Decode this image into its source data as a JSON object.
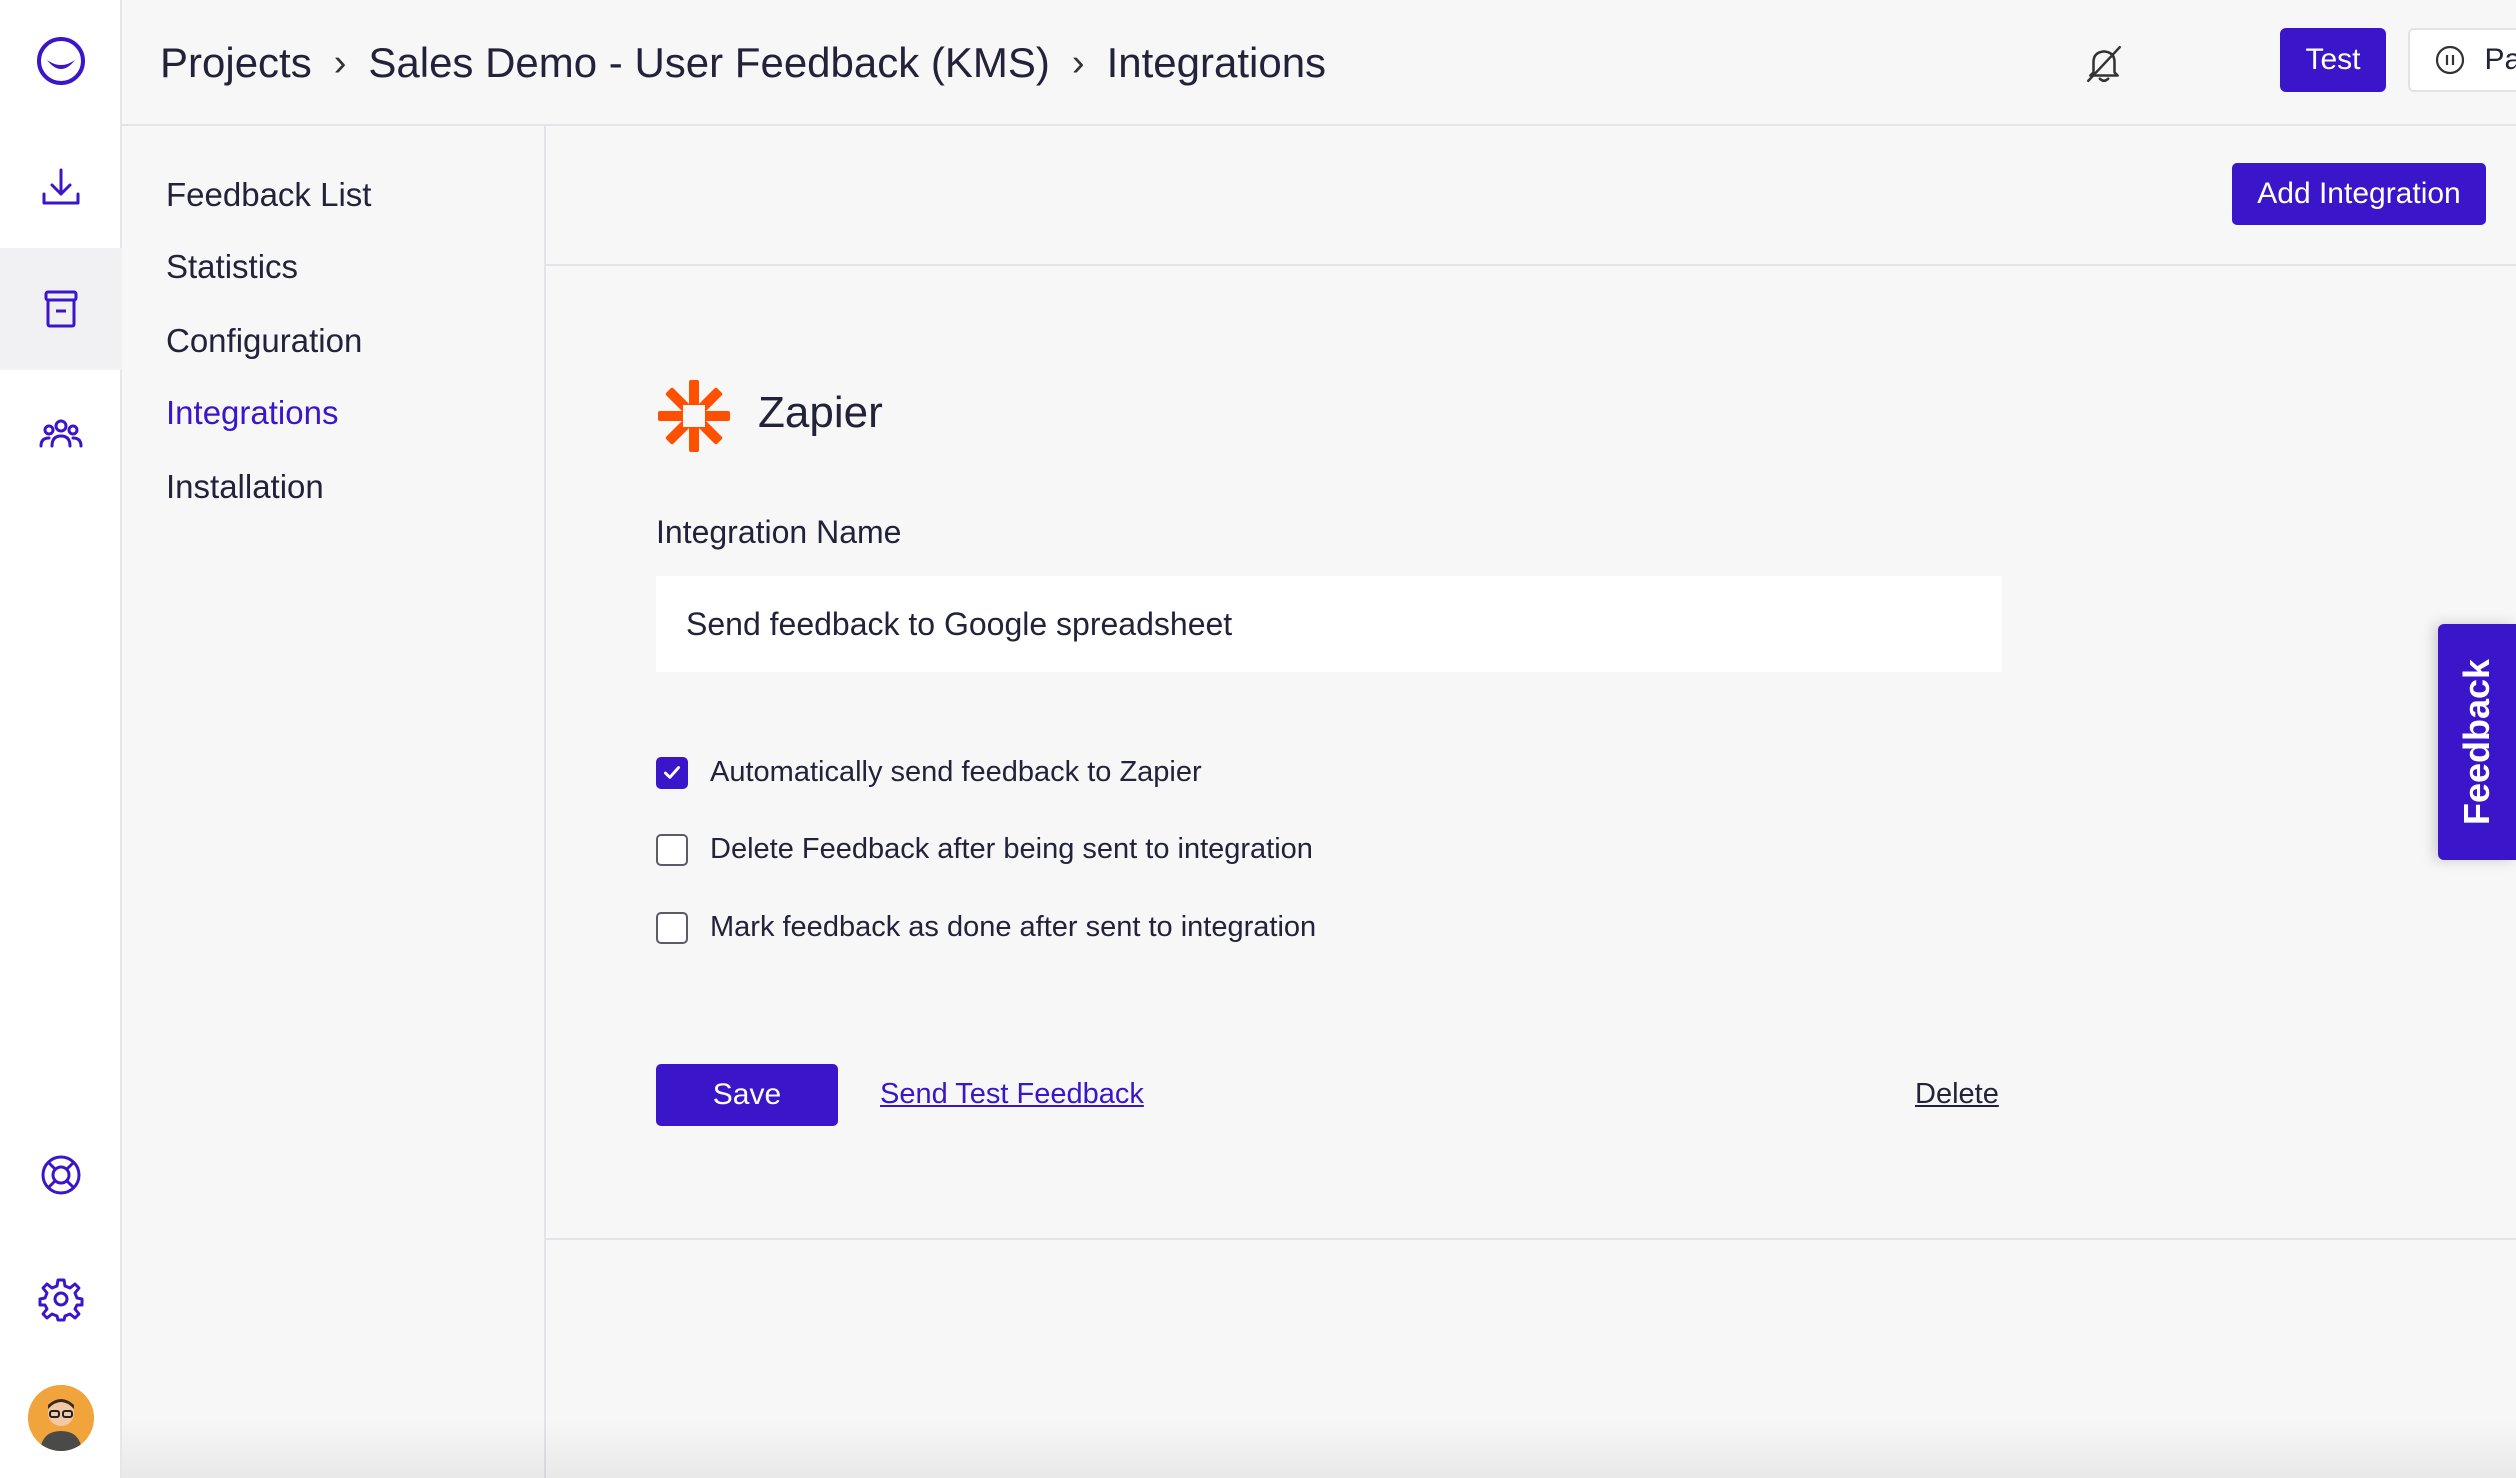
{
  "brand": {
    "accent": "#3a15c9",
    "zapier_orange": "#ff4f00"
  },
  "rail": {
    "items": [
      {
        "icon": "logo-icon"
      },
      {
        "icon": "download-icon"
      },
      {
        "icon": "inbox-icon",
        "active": true
      },
      {
        "icon": "users-icon"
      },
      {
        "icon": "lifebuoy-icon"
      },
      {
        "icon": "gear-icon"
      },
      {
        "icon": "avatar"
      }
    ]
  },
  "header": {
    "breadcrumb": [
      "Projects",
      "Sales Demo - User Feedback (KMS)",
      "Integrations"
    ],
    "separator": "›",
    "bell_icon": "bell-off-icon",
    "test_label": "Test",
    "pause_label": "Pause"
  },
  "subnav": {
    "items": [
      {
        "label": "Feedback List"
      },
      {
        "label": "Statistics"
      },
      {
        "label": "Configuration"
      },
      {
        "label": "Integrations",
        "active": true
      },
      {
        "label": "Installation"
      }
    ]
  },
  "main": {
    "add_integration_label": "Add Integration",
    "integration": {
      "title": "Zapier",
      "name_label": "Integration Name",
      "name_value": "Send feedback to Google spreadsheet",
      "options": [
        {
          "label": "Automatically send feedback to Zapier",
          "checked": true
        },
        {
          "label": "Delete Feedback after being sent to integration",
          "checked": false
        },
        {
          "label": "Mark feedback as done after sent to integration",
          "checked": false
        }
      ],
      "save_label": "Save",
      "send_test_label": "Send Test Feedback",
      "delete_label": "Delete"
    }
  },
  "feedback_tab": {
    "label": "Feedback"
  }
}
